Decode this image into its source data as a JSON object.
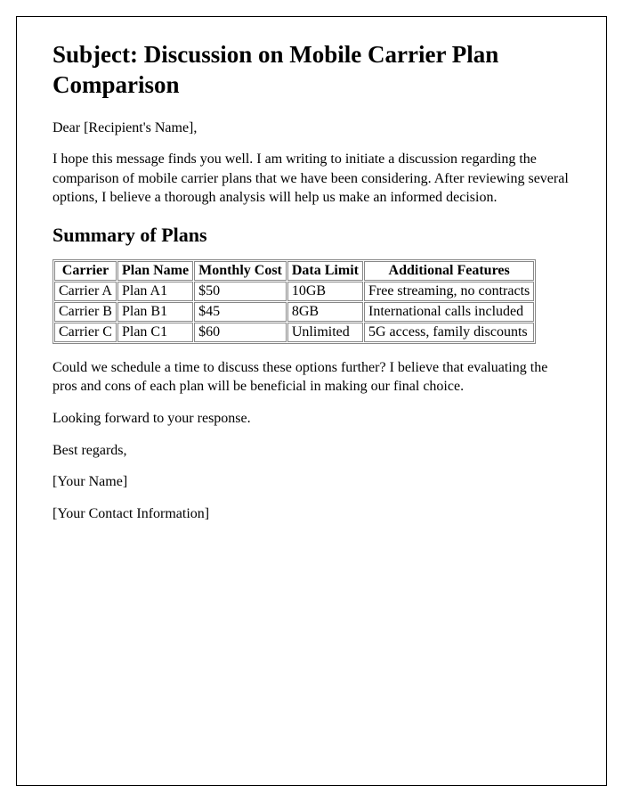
{
  "subject_line": "Subject: Discussion on Mobile Carrier Plan Comparison",
  "greeting": "Dear [Recipient's Name],",
  "intro_paragraph": "I hope this message finds you well. I am writing to initiate a discussion regarding the comparison of mobile carrier plans that we have been considering. After reviewing several options, I believe a thorough analysis will help us make an informed decision.",
  "summary_heading": "Summary of Plans",
  "table": {
    "headers": [
      "Carrier",
      "Plan Name",
      "Monthly Cost",
      "Data Limit",
      "Additional Features"
    ],
    "rows": [
      [
        "Carrier A",
        "Plan A1",
        "$50",
        "10GB",
        "Free streaming, no contracts"
      ],
      [
        "Carrier B",
        "Plan B1",
        "$45",
        "8GB",
        "International calls included"
      ],
      [
        "Carrier C",
        "Plan C1",
        "$60",
        "Unlimited",
        "5G access, family discounts"
      ]
    ]
  },
  "followup_paragraph": "Could we schedule a time to discuss these options further? I believe that evaluating the pros and cons of each plan will be beneficial in making our final choice.",
  "closing_line": "Looking forward to your response.",
  "signoff": "Best regards,",
  "sender_name": "[Your Name]",
  "sender_contact": "[Your Contact Information]"
}
